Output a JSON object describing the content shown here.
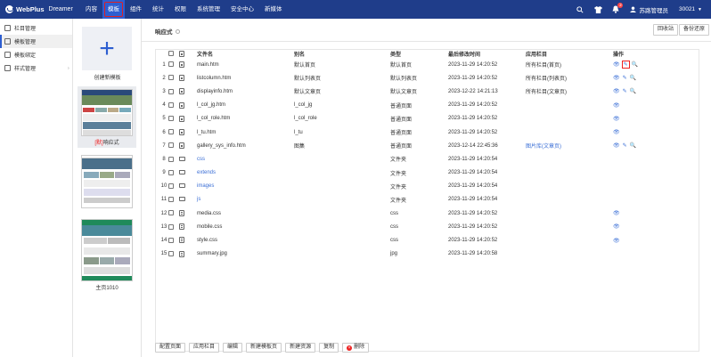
{
  "app": {
    "name": "WebPlus",
    "sub": "Dreamer"
  },
  "topnav": [
    "内容",
    "模板",
    "组件",
    "统计",
    "权限",
    "系统管理",
    "安全中心",
    "新媒体"
  ],
  "topnav_active": 1,
  "topbar": {
    "badge_count": "2",
    "user": "苏路管理员",
    "site_id": "30021"
  },
  "sidebar": {
    "items": [
      {
        "label": "栏目管理",
        "icon": "columns-icon",
        "active": false
      },
      {
        "label": "模板管理",
        "icon": "template-icon",
        "active": true
      },
      {
        "label": "模板绑定",
        "icon": "bind-icon",
        "active": false
      },
      {
        "label": "样式管理",
        "icon": "style-icon",
        "active": false,
        "expandable": true
      }
    ]
  },
  "templates": {
    "create_label": "创建新模板",
    "cards": [
      {
        "label_prefix": "[默]",
        "label": "响应式",
        "active": true
      },
      {
        "label_prefix": "",
        "label": "",
        "active": false
      },
      {
        "label_prefix": "",
        "label": "主页1010",
        "active": false
      }
    ]
  },
  "main": {
    "title": "响应式",
    "buttons": {
      "recycle": "回收站",
      "backup": "备份还原"
    },
    "columns": {
      "name": "文件名",
      "alias": "别名",
      "kind": "类型",
      "time": "最后修改时间",
      "app": "应用栏目",
      "action": "操作"
    },
    "rows": [
      {
        "no": "1",
        "icon": "page",
        "name": "main.htm",
        "alias": "默认首页",
        "kind": "默认首页",
        "time": "2023-11-29 14:20:52",
        "app": "所有栏目(首页)",
        "app_link": false,
        "actions": "full",
        "highlight": true
      },
      {
        "no": "2",
        "icon": "page",
        "name": "listcolumn.htm",
        "alias": "默认列表页",
        "kind": "默认列表页",
        "time": "2023-11-29 14:20:52",
        "app": "所有栏目(列表页)",
        "app_link": false,
        "actions": "full"
      },
      {
        "no": "3",
        "icon": "page",
        "name": "displayinfo.htm",
        "alias": "默认文章页",
        "kind": "默认文章页",
        "time": "2023-12-22 14:21:13",
        "app": "所有栏目(文章页)",
        "app_link": false,
        "actions": "full"
      },
      {
        "no": "4",
        "icon": "page",
        "name": "l_col_jg.htm",
        "alias": "l_col_jg",
        "kind": "普通页面",
        "time": "2023-11-29 14:20:52",
        "app": "",
        "app_link": false,
        "actions": "view"
      },
      {
        "no": "5",
        "icon": "page",
        "name": "l_col_role.htm",
        "alias": "l_col_role",
        "kind": "普通页面",
        "time": "2023-11-29 14:20:52",
        "app": "",
        "app_link": false,
        "actions": "view"
      },
      {
        "no": "6",
        "icon": "page",
        "name": "l_tu.htm",
        "alias": "l_tu",
        "kind": "普通页面",
        "time": "2023-11-29 14:20:52",
        "app": "",
        "app_link": false,
        "actions": "view"
      },
      {
        "no": "7",
        "icon": "page",
        "name": "gallery_sys_info.htm",
        "alias": "图集",
        "kind": "普通页面",
        "time": "2023-12-14 22:45:36",
        "app": "图片库(文章页)",
        "app_link": true,
        "actions": "full"
      },
      {
        "no": "8",
        "icon": "folder",
        "name": "css",
        "alias": "",
        "kind": "文件夹",
        "time": "2023-11-29 14:20:54",
        "app": "",
        "app_link": false,
        "actions": "",
        "name_link": true
      },
      {
        "no": "9",
        "icon": "folder",
        "name": "extends",
        "alias": "",
        "kind": "文件夹",
        "time": "2023-11-29 14:20:54",
        "app": "",
        "app_link": false,
        "actions": "",
        "name_link": true
      },
      {
        "no": "10",
        "icon": "folder",
        "name": "images",
        "alias": "",
        "kind": "文件夹",
        "time": "2023-11-29 14:20:54",
        "app": "",
        "app_link": false,
        "actions": "",
        "name_link": true
      },
      {
        "no": "11",
        "icon": "folder",
        "name": "js",
        "alias": "",
        "kind": "文件夹",
        "time": "2023-11-29 14:20:54",
        "app": "",
        "app_link": false,
        "actions": "",
        "name_link": true
      },
      {
        "no": "12",
        "icon": "file",
        "name": "media.css",
        "alias": "",
        "kind": "css",
        "time": "2023-11-29 14:20:52",
        "app": "",
        "app_link": false,
        "actions": "view"
      },
      {
        "no": "13",
        "icon": "file",
        "name": "mobile.css",
        "alias": "",
        "kind": "css",
        "time": "2023-11-29 14:20:52",
        "app": "",
        "app_link": false,
        "actions": "view"
      },
      {
        "no": "14",
        "icon": "file",
        "name": "style.css",
        "alias": "",
        "kind": "css",
        "time": "2023-11-29 14:20:52",
        "app": "",
        "app_link": false,
        "actions": "view"
      },
      {
        "no": "15",
        "icon": "file",
        "name": "summary.jpg",
        "alias": "",
        "kind": "jpg",
        "time": "2023-11-29 14:20:58",
        "app": "",
        "app_link": false,
        "actions": ""
      }
    ],
    "footer_buttons": [
      "配置页面",
      "应用栏目",
      "编辑",
      "新建模板页",
      "新建资源",
      "复制",
      "删除"
    ]
  },
  "colors": {
    "topbar": "#1f3d8a",
    "accent": "#2d5ed1",
    "link": "#3b6fd6",
    "danger": "#e22222"
  }
}
